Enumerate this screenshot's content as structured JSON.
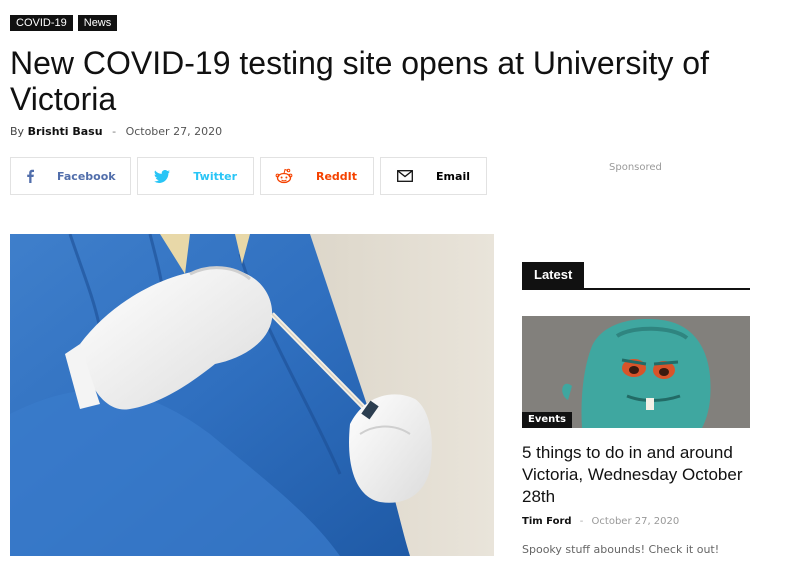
{
  "tags": [
    "COVID-19",
    "News"
  ],
  "article": {
    "title": "New COVID-19 testing site opens at University of Victoria",
    "by_label": "By",
    "author": "Brishti Basu",
    "separator": "-",
    "date": "October 27, 2020"
  },
  "share": [
    {
      "label": "Facebook",
      "icon": "facebook-icon",
      "color": "#516eab"
    },
    {
      "label": "Twitter",
      "icon": "twitter-icon",
      "color": "#29c5f6"
    },
    {
      "label": "ReddIt",
      "icon": "reddit-icon",
      "color": "#f54200"
    },
    {
      "label": "Email",
      "icon": "email-icon",
      "color": "#000000"
    }
  ],
  "sponsored": "Sponsored",
  "sidebar": {
    "heading": "Latest",
    "card": {
      "category": "Events",
      "title": "5 things to do in and around Victoria, Wednesday October 28th",
      "author": "Tim Ford",
      "separator": "-",
      "date": "October 27, 2020",
      "excerpt": "Spooky stuff abounds! Check it out!"
    }
  }
}
